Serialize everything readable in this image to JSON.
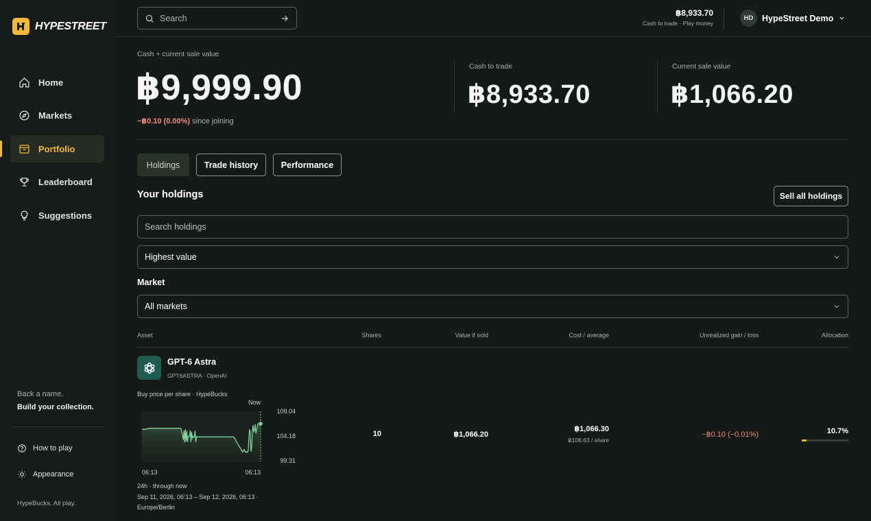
{
  "app": {
    "name": "HYPESTREET"
  },
  "sidebar": {
    "items": [
      {
        "label": "Home",
        "icon": "home-icon"
      },
      {
        "label": "Markets",
        "icon": "compass-icon"
      },
      {
        "label": "Portfolio",
        "icon": "portfolio-icon",
        "active": true
      },
      {
        "label": "Leaderboard",
        "icon": "trophy-icon"
      },
      {
        "label": "Suggestions",
        "icon": "lightbulb-icon"
      }
    ],
    "promo_line1": "Back a name.",
    "promo_line2": "Build your collection.",
    "how_to_play": "How to play",
    "appearance": "Appearance",
    "footer": "HypeBucks. All play."
  },
  "header": {
    "search_placeholder": "Search",
    "cash_value": "฿8,933.70",
    "cash_sub": "Cash to trade · Play money",
    "user_initials": "HD",
    "user_name": "HypeStreet Demo"
  },
  "summary": {
    "total_label": "Cash + current sale value",
    "total_value": "฿9,999.90",
    "delta_value": "−฿0.10 (0.00%)",
    "delta_since": "since joining",
    "cash_label": "Cash to trade",
    "cash_value": "฿8,933.70",
    "sale_label": "Current sale value",
    "sale_value": "฿1,066.20"
  },
  "tabs": [
    "Holdings",
    "Trade history",
    "Performance"
  ],
  "holdings": {
    "title": "Your holdings",
    "sell_all": "Sell all holdings",
    "search_placeholder": "Search holdings",
    "sort_value": "Highest value",
    "market_label": "Market",
    "market_value": "All markets",
    "columns": [
      "Asset",
      "Shares",
      "Value if sold",
      "Cost / average",
      "Unrealized gain / loss",
      "Allocation"
    ],
    "rows": [
      {
        "name": "GPT-6 Astra",
        "sub": "GPT6ASTRA · OpenAI",
        "chart_caption": "Buy price per share · HypeBucks",
        "chart_now": "Now",
        "chart_y_ticks": [
          "109.04",
          "104.18",
          "99.31"
        ],
        "chart_x_start": "06:13",
        "chart_x_end": "06:13",
        "chart_range": "24h · through now",
        "chart_period": "Sep 11, 2026, 06:13 – Sep 12, 2026, 06:13 ·",
        "chart_tz": "Europe/Berlin",
        "shares": "10",
        "value_if_sold": "฿1,066.20",
        "cost": "฿1,066.30",
        "average": "฿106.63 / share",
        "gain": "−฿0.10 (−0.01%)",
        "allocation": "10.7%",
        "allocation_fraction": 0.107
      }
    ]
  },
  "colors": {
    "accent": "#f0b93a",
    "negative": "#f08a7c",
    "chart_line": "#7fd39a",
    "background": "#151a17"
  },
  "chart_data": {
    "type": "line",
    "title": "Buy price per share · HypeBucks",
    "xlabel": "",
    "ylabel": "",
    "ylim": [
      99.31,
      109.04
    ],
    "y_ticks": [
      109.04,
      104.18,
      99.31
    ],
    "x_tick_labels": [
      "06:13",
      "06:13"
    ],
    "series": [
      {
        "values": [
          105.5,
          105.5,
          105.5,
          105.5,
          105.5,
          105.5,
          105.5,
          105.6,
          105.6,
          105.6,
          105.7,
          105.7,
          105.7,
          105.7,
          105.7,
          105.7,
          105.7,
          105.7,
          105.7,
          105.7,
          105.7,
          105.7,
          105.7,
          105.7,
          105.7,
          105.7,
          105.7,
          105.7,
          105.7,
          105.7,
          105.7,
          105.7,
          105.7,
          105.7,
          105.7,
          105.7,
          105.7,
          105.7,
          105.7,
          105.7,
          105.7,
          105.7,
          105.7,
          105.7,
          105.7,
          105.7,
          105.7,
          105.7,
          105.7,
          105.7,
          105.7,
          105.7,
          105.7,
          105.7,
          105.7,
          105.7,
          105.7,
          105.5,
          104.9,
          104.2,
          103.4,
          105.3,
          102.9,
          105.5,
          103.1,
          105.2,
          103.0,
          104.1,
          104.1,
          104.2,
          105.3,
          103.0,
          105.0,
          103.8,
          104.1,
          103.9,
          104.0,
          105.2,
          103.0,
          104.0,
          104.0,
          104.0,
          104.0,
          104.0,
          104.0,
          104.0,
          104.0,
          104.0,
          104.0,
          104.0,
          104.0,
          104.0,
          104.0,
          104.0,
          104.0,
          104.0,
          104.0,
          104.0,
          104.0,
          104.0,
          104.0,
          104.0,
          104.0,
          104.0,
          104.0,
          104.0,
          104.0,
          104.0,
          104.0,
          104.0,
          104.0,
          104.0,
          104.0,
          104.0,
          104.0,
          104.0,
          104.0,
          104.0,
          104.0,
          104.0,
          104.0,
          104.0,
          104.0,
          104.0,
          104.0,
          104.0,
          104.0,
          104.0,
          104.0,
          104.0,
          104.0,
          104.0,
          104.0,
          104.0,
          103.8,
          103.6,
          103.3,
          103.0,
          102.8,
          102.6,
          102.3,
          102.1,
          101.9,
          101.7,
          101.5,
          101.2,
          101.0,
          101.2,
          101.5,
          101.3,
          101.0,
          100.9,
          101.1,
          101.0,
          101.3,
          103.8,
          105.5,
          104.8,
          101.1,
          101.8,
          104.8,
          106.3,
          105.1,
          105.3,
          106.5,
          104.7,
          105.3,
          105.9,
          106.6,
          106.6,
          106.6,
          106.6,
          106.6
        ]
      }
    ]
  }
}
